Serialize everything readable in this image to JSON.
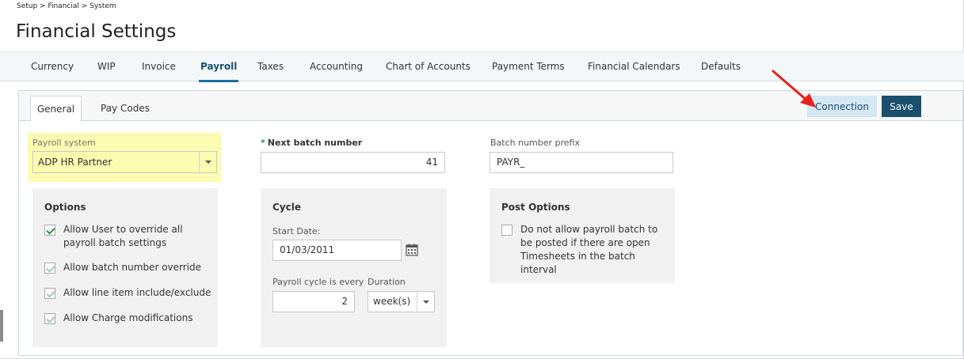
{
  "breadcrumb": "Setup > Financial > System",
  "page_title": "Financial Settings",
  "tabs": [
    {
      "label": "Currency"
    },
    {
      "label": "WIP"
    },
    {
      "label": "Invoice"
    },
    {
      "label": "Payroll"
    },
    {
      "label": "Taxes"
    },
    {
      "label": "Accounting"
    },
    {
      "label": "Chart of Accounts"
    },
    {
      "label": "Payment Terms"
    },
    {
      "label": "Financial Calendars"
    },
    {
      "label": "Defaults"
    }
  ],
  "active_tab": "Payroll",
  "subtabs": [
    {
      "label": "General"
    },
    {
      "label": "Pay Codes"
    }
  ],
  "active_subtab": "General",
  "buttons": {
    "connection": "Connection",
    "save": "Save"
  },
  "payroll_system": {
    "label": "Payroll system",
    "value": "ADP HR Partner"
  },
  "next_batch": {
    "required_mark": "*",
    "label": "Next batch number",
    "value": "41"
  },
  "batch_prefix": {
    "label": "Batch number prefix",
    "value": "PAYR_"
  },
  "options": {
    "title": "Options",
    "items": [
      {
        "label": "Allow User to override all payroll batch settings",
        "checked": true
      },
      {
        "label": "Allow batch number override",
        "checked": true
      },
      {
        "label": "Allow line item include/exclude",
        "checked": true
      },
      {
        "label": "Allow Charge modifications",
        "checked": true
      }
    ]
  },
  "cycle": {
    "title": "Cycle",
    "start_date_label": "Start Date:",
    "start_date": "01/03/2011",
    "every_label": "Payroll cycle is every",
    "every_value": "2",
    "duration_label": "Duration",
    "duration_value": "week(s)"
  },
  "post_options": {
    "title": "Post Options",
    "item": {
      "label": "Do not allow payroll batch to be posted if there are open Timesheets in the batch interval",
      "checked": false
    }
  },
  "colors": {
    "primary": "#1a4f6e",
    "connection_bg": "#d5e7f3",
    "highlight": "#fbfcb0",
    "annotation_arrow": "#e8221c",
    "check": "#2e8b57"
  }
}
